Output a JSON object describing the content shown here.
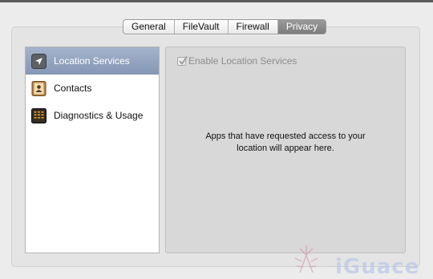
{
  "tabs": [
    {
      "label": "General",
      "selected": false
    },
    {
      "label": "FileVault",
      "selected": false
    },
    {
      "label": "Firewall",
      "selected": false
    },
    {
      "label": "Privacy",
      "selected": true
    }
  ],
  "sidebar": {
    "items": [
      {
        "label": "Location Services",
        "icon": "location-arrow-icon",
        "selected": true
      },
      {
        "label": "Contacts",
        "icon": "contacts-book-icon",
        "selected": false
      },
      {
        "label": "Diagnostics & Usage",
        "icon": "diagnostics-console-icon",
        "selected": false
      }
    ]
  },
  "content": {
    "enable_label": "Enable Location Services",
    "enable_checked": true,
    "enable_disabled": true,
    "message_line1": "Apps that have requested access to your",
    "message_line2": "location will appear here."
  },
  "watermark": {
    "text": "iGuace"
  },
  "colors": {
    "selection": "#8b9cba",
    "tab_selected": "#8a8a8a",
    "disabled_text": "#8c8c8c"
  }
}
